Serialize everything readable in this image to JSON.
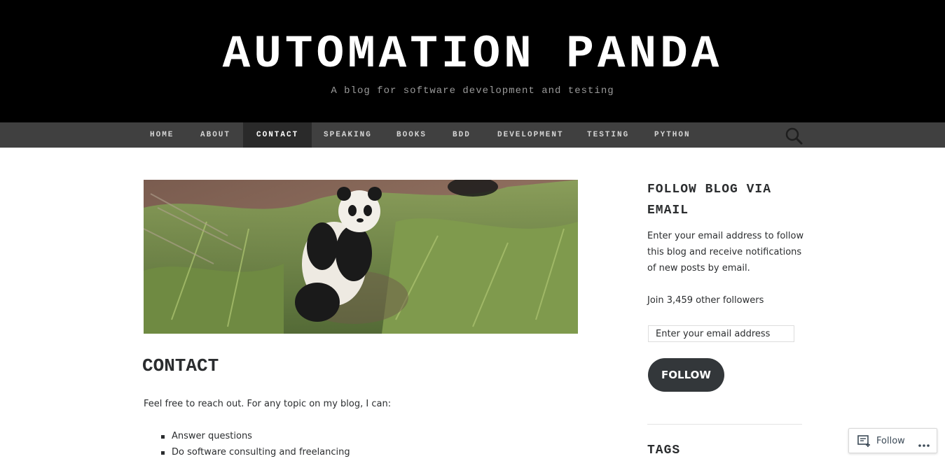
{
  "header": {
    "title": "AUTOMATION PANDA",
    "description": "A blog for software development and testing"
  },
  "nav": {
    "items": [
      "HOME",
      "ABOUT",
      "CONTACT",
      "SPEAKING",
      "BOOKS",
      "BDD",
      "DEVELOPMENT",
      "TESTING",
      "PYTHON"
    ],
    "active": "CONTACT",
    "search_icon": "search-icon"
  },
  "main": {
    "hero_image": "panda-eating-bamboo",
    "title": "CONTACT",
    "intro": "Feel free to reach out. For any topic on my blog, I can:",
    "list": [
      "Answer questions",
      "Do software consulting and freelancing"
    ]
  },
  "sidebar": {
    "follow_title": "FOLLOW BLOG VIA EMAIL",
    "follow_text": "Enter your email address to follow this blog and receive notifications of new posts by email.",
    "followers_text": "Join 3,459 other followers",
    "email_placeholder": "Enter your email address",
    "follow_button": "FOLLOW",
    "tags_title": "TAGS"
  },
  "follow_badge": {
    "label": "Follow",
    "icon": "reader-follow-icon",
    "more_icon": "more-dots-icon"
  },
  "colors": {
    "header_bg": "#000000",
    "nav_bg": "#404040",
    "nav_active_bg": "#2a2a2a",
    "button_bg": "#33373a"
  }
}
